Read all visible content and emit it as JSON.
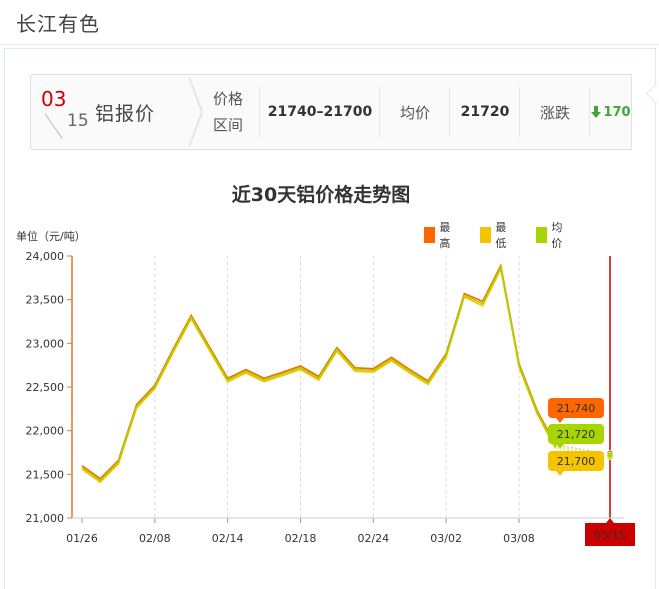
{
  "site": {
    "title": "长江有色"
  },
  "pricebar": {
    "month": "03",
    "day": "15",
    "metal_label": "铝报价",
    "price_label_1": "价格",
    "price_label_2": "区间",
    "price_range": "21740–21700",
    "avg_label": "均价",
    "avg_value": "21720",
    "change_label": "涨跌",
    "change_value": "170",
    "change_direction": "down",
    "change_color": "#3fa63a"
  },
  "chart_data": {
    "type": "line",
    "title": "近30天铝价格走势图",
    "ylabel": "单位（元/吨）",
    "ylim": [
      21000,
      24000
    ],
    "yticks": [
      21000,
      21500,
      22000,
      22500,
      23000,
      23500,
      24000
    ],
    "ytick_labels": [
      "21,000",
      "21,500",
      "22,000",
      "22,500",
      "23,000",
      "23,500",
      "24,000"
    ],
    "x_tick_labels": [
      "01/26",
      "02/08",
      "02/14",
      "02/18",
      "02/24",
      "03/02",
      "03/08",
      "03/15"
    ],
    "x": [
      "01/26",
      "01/27",
      "01/28",
      "01/29",
      "02/08",
      "02/09",
      "02/10",
      "02/11",
      "02/14",
      "02/15",
      "02/16",
      "02/17",
      "02/18",
      "02/21",
      "02/22",
      "02/23",
      "02/24",
      "02/25",
      "02/28",
      "03/01",
      "03/02",
      "03/03",
      "03/04",
      "03/07",
      "03/08",
      "03/09",
      "03/10",
      "03/11",
      "03/14",
      "03/15"
    ],
    "series": [
      {
        "name": "最高",
        "color": "#ff6600",
        "values": [
          21600,
          21450,
          21660,
          22300,
          22520,
          22930,
          23320,
          22960,
          22600,
          22700,
          22600,
          22670,
          22740,
          22620,
          22950,
          22720,
          22710,
          22840,
          22700,
          22570,
          22880,
          23570,
          23480,
          23890,
          22770,
          22230,
          21840,
          null,
          null,
          21740
        ]
      },
      {
        "name": "最低",
        "color": "#f5c400",
        "values": [
          21560,
          21410,
          21620,
          22260,
          22480,
          22890,
          23280,
          22920,
          22560,
          22660,
          22560,
          22630,
          22700,
          22580,
          22910,
          22680,
          22670,
          22800,
          22660,
          22530,
          22840,
          23530,
          23430,
          23850,
          22730,
          22190,
          21800,
          null,
          null,
          21700
        ]
      },
      {
        "name": "均价",
        "color": "#a8d400",
        "values": [
          21580,
          21430,
          21640,
          22280,
          22500,
          22910,
          23300,
          22940,
          22580,
          22680,
          22580,
          22650,
          22720,
          22600,
          22930,
          22700,
          22690,
          22820,
          22680,
          22550,
          22860,
          23550,
          23455,
          23870,
          22750,
          22210,
          21820,
          null,
          null,
          21720
        ]
      }
    ],
    "tooltip": {
      "high": "21,740",
      "avg": "21,720",
      "low": "21,700"
    },
    "grid": "vertical-dashed",
    "legend_position": "top-right",
    "highlight_date": "03/15",
    "highlight_color": "#cc0000"
  }
}
